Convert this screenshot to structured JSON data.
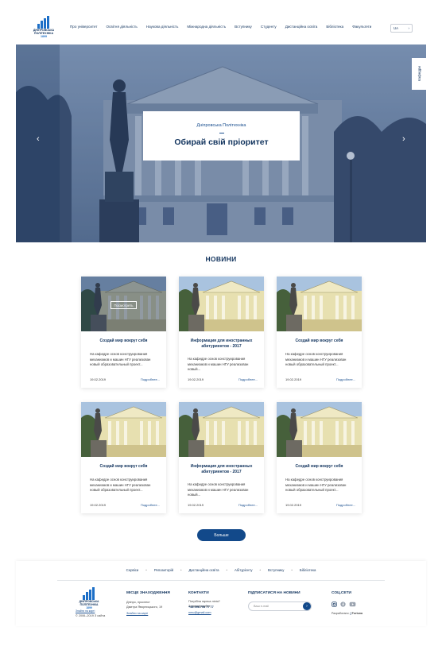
{
  "header": {
    "logo_lines": [
      "ДНІПРОВСЬКА",
      "ПОЛІТЕХНІКА",
      "1899"
    ],
    "nav": [
      "Про університет",
      "Освітня діяльність",
      "Наукова діяльність",
      "Міжнародна діяльність",
      "Вступнику",
      "Студенту",
      "Дистанційна освіта",
      "Бібліотека",
      "Факультети"
    ],
    "lang": "UA",
    "lang_arrow": "›"
  },
  "hero": {
    "subtitle": "Дніпровська Політехніка",
    "dash": "—",
    "title": "Обирай свій пріоритет",
    "prev": "‹",
    "next": "›",
    "side_tab": "Кафедри"
  },
  "news": {
    "title": "НОВИНИ",
    "view_label": "Посмотреть",
    "cards": [
      {
        "title": "Создай мир вокруг себя",
        "text": "На кафедре основ конструирования механизмов и машин НГУ реализован новый образовательный проект...",
        "date": "19.02.2019",
        "more": "Подробнее..."
      },
      {
        "title": "Информация для иностранных абитуриентов - 2017",
        "text": "На кафедре основ конструирования механизмов и машин НГУ реализован новый...",
        "date": "19.02.2019",
        "more": "Подробнее..."
      },
      {
        "title": "Создай мир вокруг себя",
        "text": "На кафедре основ конструирования механизмов и машин НГУ реализован новый образовательный проект...",
        "date": "19.02.2019",
        "more": "Подробнее..."
      },
      {
        "title": "Создай мир вокруг себя",
        "text": "На кафедре основ конструирования механизмов и машин НГУ реализован новый образовательный проект...",
        "date": "19.02.2019",
        "more": "Подробнее..."
      },
      {
        "title": "Информация для иностранных абитуриентов - 2017",
        "text": "На кафедре основ конструирования механизмов и машин НГУ реализован новый...",
        "date": "19.02.2019",
        "more": "Подробнее..."
      },
      {
        "title": "Создай мир вокруг себя",
        "text": "На кафедре основ конструирования механизмов и машин НГУ реализован новый образовательный проект...",
        "date": "19.02.2019",
        "more": "Подробнее..."
      }
    ],
    "more_button": "Больше"
  },
  "footer": {
    "links": [
      "Сервіси",
      "Репозиторій",
      "Дистанційна освіта",
      "Абітурієнту",
      "Вступнику",
      "Бібліотека"
    ],
    "logo_lines": [
      "ДНІПРОВСЬКА",
      "ПОЛІТЕХНІКА",
      "1899"
    ],
    "logo_link": "Знайти на карті",
    "location_title": "МІСЦЕ ЗНАХОДЖЕННЯ",
    "address_1": "Дніпро, проспект",
    "address_2": "Дмитра Яворницького, 19",
    "map_link": "Знайти на карті",
    "contacts_title": "КОНТАКТИ",
    "contacts_label": "Потрібна гаряча лінія? Зателефонуйте",
    "phone": "+38 096 706 77 77",
    "email": "nmu@gmail.com",
    "subscribe_title": "ПІДПИСАТИСЯ НА НОВИНИ",
    "email_placeholder": "Ваш e-mail",
    "send": "›",
    "social_title": "СОЦ.СЕТИ",
    "developer_label": "Разработано:",
    "developer": "Fortuna",
    "copyright": "© 2006–2019 З сайта"
  },
  "colors": {
    "brand": "#12345e",
    "accent": "#12498a",
    "logo": "#1d6fc7"
  }
}
